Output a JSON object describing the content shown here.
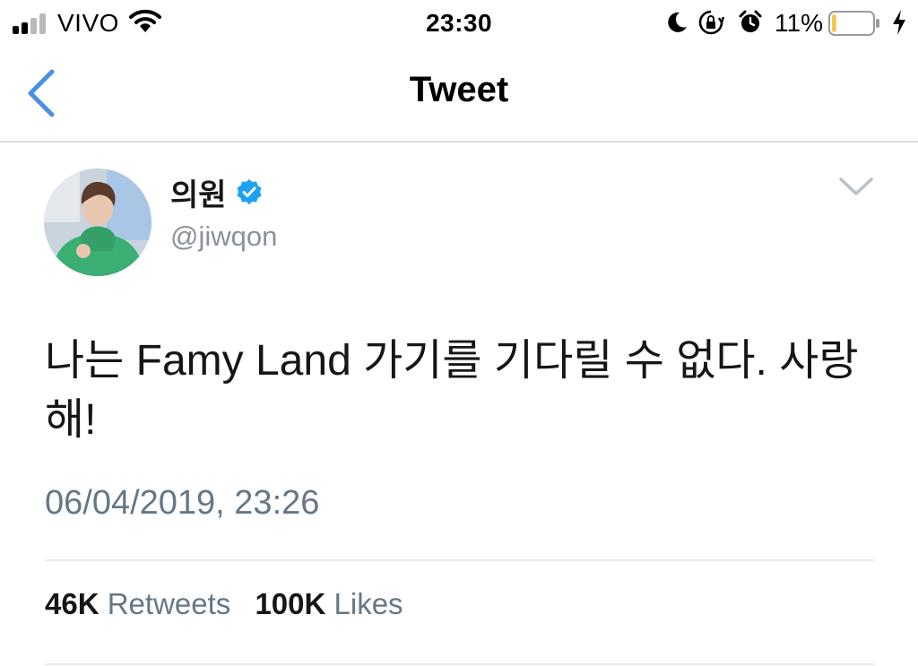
{
  "status_bar": {
    "carrier": "VIVO",
    "time": "23:30",
    "battery_percent": "11%",
    "battery_level": 0.11,
    "icons": [
      "signal-icon",
      "wifi-icon",
      "moon-icon",
      "rotation-lock-icon",
      "alarm-icon",
      "battery-icon",
      "charging-bolt-icon"
    ]
  },
  "nav": {
    "title": "Tweet",
    "back_icon": "chevron-left-icon"
  },
  "tweet": {
    "display_name": "의원",
    "verified": true,
    "handle": "@jiwqon",
    "text": "나는 Famy Land 가기를 기다릴 수 없다. 사랑해!",
    "timestamp": "06/04/2019, 23:26",
    "retweets_count": "46K",
    "retweets_label": "Retweets",
    "likes_count": "100K",
    "likes_label": "Likes"
  },
  "colors": {
    "accent": "#4a90e2",
    "verified_badge": "#1da1f2",
    "secondary_text": "#657786",
    "divider": "#e6ecf0",
    "battery_fill": "#f5c84c"
  }
}
